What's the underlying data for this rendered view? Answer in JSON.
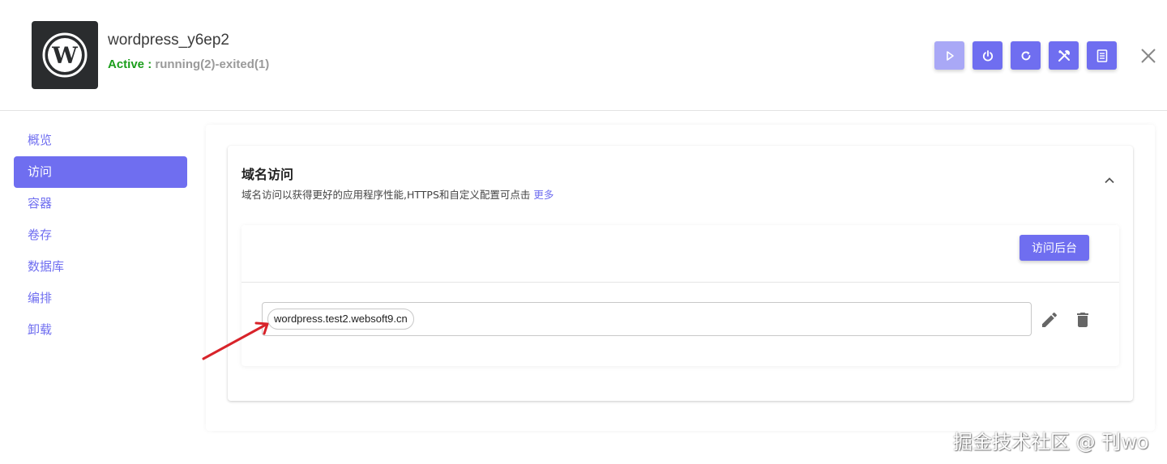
{
  "app": {
    "name": "wordpress_y6ep2",
    "status_label": "Active :",
    "status_detail": "running(2)-exited(1)",
    "logo_icon": "wordpress-logo"
  },
  "toolbar": {
    "buttons": [
      {
        "icon": "play-icon",
        "state": "disabled"
      },
      {
        "icon": "power-icon",
        "state": "enabled"
      },
      {
        "icon": "restart-icon",
        "state": "enabled"
      },
      {
        "icon": "tools-icon",
        "state": "enabled"
      },
      {
        "icon": "document-icon",
        "state": "enabled"
      }
    ],
    "accent": "#6f6ef0"
  },
  "sidebar": {
    "items": [
      {
        "label": "概览"
      },
      {
        "label": "访问",
        "active": true
      },
      {
        "label": "容器"
      },
      {
        "label": "卷存"
      },
      {
        "label": "数据库"
      },
      {
        "label": "编排"
      },
      {
        "label": "卸载"
      }
    ]
  },
  "panel": {
    "title": "域名访问",
    "description": "域名访问以获得更好的应用程序性能,HTTPS和自定义配置可点击",
    "more_link": "更多",
    "visit_admin_label": "访问后台",
    "domains": [
      "wordpress.test2.websoft9.cn"
    ]
  },
  "watermark": "掘金技术社区 @ 刊wo"
}
